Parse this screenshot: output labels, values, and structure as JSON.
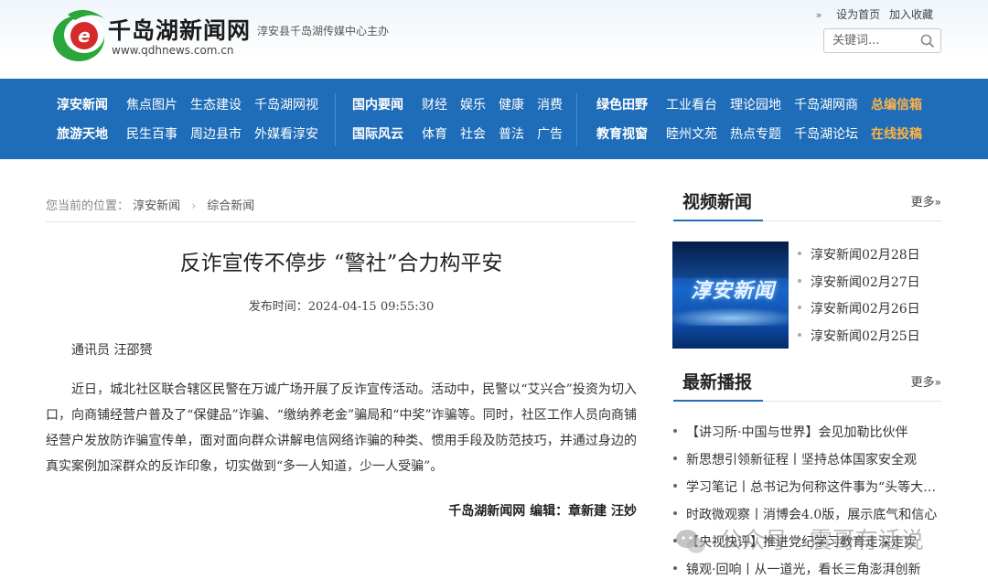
{
  "header": {
    "site_title": "千岛湖新闻网",
    "site_url": "www.qdhnews.com.cn",
    "logo_letter": "e",
    "host": "淳安县千岛湖传媒中心主办",
    "links": [
      "设为首页",
      "加入收藏"
    ],
    "search_placeholder": "关键词..."
  },
  "nav": {
    "groups": [
      {
        "rows": [
          {
            "head": "淳安新闻",
            "items": [
              "焦点图片",
              "生态建设",
              "千岛湖网视"
            ]
          },
          {
            "head": "旅游天地",
            "items": [
              "民生百事",
              "周边县市",
              "外媒看淳安"
            ]
          }
        ]
      },
      {
        "rows": [
          {
            "head": "国内要闻",
            "items": [
              "财经",
              "娱乐",
              "健康",
              "消费"
            ]
          },
          {
            "head": "国际风云",
            "items": [
              "体育",
              "社会",
              "普法",
              "广告"
            ]
          }
        ]
      },
      {
        "rows": [
          {
            "head": "绿色田野",
            "items": [
              "工业看台",
              "理论园地",
              "千岛湖网商"
            ],
            "highlight": "总编信箱"
          },
          {
            "head": "教育视窗",
            "items": [
              "睦州文苑",
              "热点专题",
              "千岛湖论坛"
            ],
            "highlight": "在线投稿"
          }
        ]
      }
    ],
    "highlight_color": "#ffb347"
  },
  "breadcrumb": {
    "prefix": "您当前的位置：",
    "items": [
      "淳安新闻",
      "综合新闻"
    ]
  },
  "article": {
    "title": "反诈宣传不停步 “警社”合力构平安",
    "pub_time": "发布时间：2024-04-15 09:55:30",
    "byline": "通讯员 汪邵赟",
    "body": "近日，城北社区联合辖区民警在万诚广场开展了反诈宣传活动。活动中，民警以“艾兴合”投资为切入口，向商铺经营户普及了“保健品”诈骗、“缴纳养老金”骗局和“中奖”诈骗等。同时，社区工作人员向商铺经营户发放防诈骗宣传单，面对面向群众讲解电信网络诈骗的种类、惯用手段及防范技巧，并通过身边的真实案例加深群众的反诈印象，切实做到“多一人知道，少一人受骗”。",
    "footer": "千岛湖新闻网 编辑：章新建 汪妙"
  },
  "sidebar": {
    "video": {
      "title": "视频新闻",
      "more": "更多",
      "thumb_text": "淳安新闻",
      "items": [
        "淳安新闻02月28日",
        "淳安新闻02月27日",
        "淳安新闻02月26日",
        "淳安新闻02月25日"
      ]
    },
    "latest": {
      "title": "最新播报",
      "more": "更多",
      "items": [
        "【讲习所·中国与世界】会见加勒比伙伴",
        "新思想引领新征程丨坚持总体国家安全观",
        "学习笔记丨总书记为何称这件事为“头等大事”",
        "时政微观察丨消博会4.0版，展示底气和信心",
        "【央视快评】推进党纪学习教育走深走实",
        "镜观·回响丨从一道光，看长三角澎湃创新"
      ]
    }
  },
  "watermark": "公众号 · 震哥有话说",
  "colors": {
    "nav_bg": "#1f6db8",
    "accent": "#1f6db8",
    "logo_green": "#2aa63a",
    "logo_red": "#d62a2a"
  }
}
